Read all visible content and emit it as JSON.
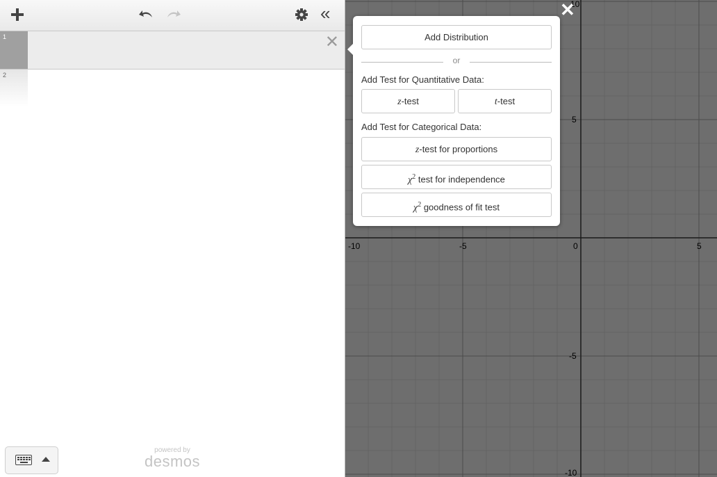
{
  "toolbar": {
    "add_icon": "plus-icon",
    "undo_icon": "undo-icon",
    "redo_icon": "redo-icon",
    "settings_icon": "gear-icon",
    "collapse_glyph": "«"
  },
  "expressions": [
    {
      "index": "1",
      "value": ""
    },
    {
      "index": "2",
      "value": ""
    }
  ],
  "expression_close_glyph": "✕",
  "footer": {
    "powered_by": "powered by",
    "brand": "desmos"
  },
  "popover": {
    "add_distribution": "Add Distribution",
    "or": "or",
    "quant_title": "Add Test for Quantitative Data:",
    "z_test_var": "z",
    "z_test_suffix": "-test",
    "t_test_var": "t",
    "t_test_suffix": "-test",
    "cat_title": "Add Test for Categorical Data:",
    "z_prop_var": "z",
    "z_prop_suffix": "-test for proportions",
    "chi_symbol": "χ",
    "chi_power": "2",
    "indep_suffix": " test for independence",
    "gof_suffix": " goodness of fit test"
  },
  "graph": {
    "close_glyph": "✕",
    "background": "#6e6e6e",
    "x_tick_labels": [
      "-10",
      "-5",
      "0",
      "5"
    ],
    "y_tick_labels": [
      "10",
      "5",
      "-5",
      "-10"
    ]
  }
}
